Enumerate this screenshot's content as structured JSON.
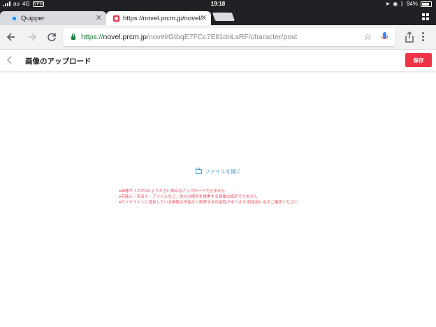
{
  "status_bar": {
    "carrier": "au",
    "network": "4G",
    "vpn": "VPN",
    "time": "19:18",
    "battery": "94%",
    "battery_level": 0.94
  },
  "tabs": [
    {
      "title": "Quipper",
      "active": false
    },
    {
      "title": "https://novel.prcm.jp/novel/",
      "active": true
    }
  ],
  "address_bar": {
    "scheme": "https://",
    "host": "novel.prcm.jp",
    "path": "/novel/GtbqE7FCc7Ell1dnLsRF/character/post"
  },
  "header": {
    "back_icon": "chevron-left-icon",
    "title": "画像のアップロード",
    "save_label": "保存"
  },
  "upload": {
    "open_file_label": "ファイルを開く",
    "icon": "folder-icon"
  },
  "notes": [
    "画像サイズが2M より大きい場合はアップロードできません",
    "芸能人・有名人・アイドルなど、他人の権利を侵害する画像は設定できません",
    "ガイドラインに違反している画像は予告なく削除する可能性があります 設定前に必ずご確認ください"
  ],
  "note_bullet": "●",
  "colors": {
    "accent": "#ef3347",
    "link": "#4ea3e0",
    "warning_text": "#e84a5f",
    "secure_green": "#188038"
  }
}
